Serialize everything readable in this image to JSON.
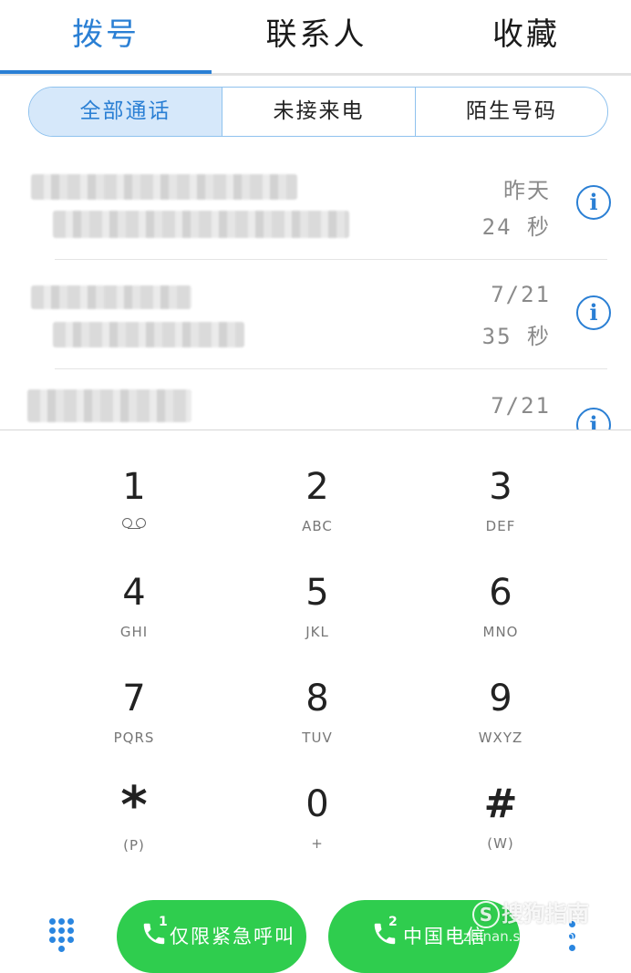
{
  "tabs": [
    {
      "label": "拨号",
      "active": true
    },
    {
      "label": "联系人",
      "active": false
    },
    {
      "label": "收藏",
      "active": false
    }
  ],
  "filters": [
    {
      "label": "全部通话",
      "active": true
    },
    {
      "label": "未接来电",
      "active": false
    },
    {
      "label": "陌生号码",
      "active": false
    }
  ],
  "call_log": [
    {
      "when": "昨天",
      "duration": "24 秒",
      "info_icon": "info-icon"
    },
    {
      "when": "7/21",
      "duration": "35 秒",
      "info_icon": "info-icon"
    },
    {
      "when": "7/21",
      "duration": "",
      "info_icon": "info-icon"
    }
  ],
  "keypad": [
    {
      "digit": "1",
      "letters": "",
      "icon": "voicemail-icon"
    },
    {
      "digit": "2",
      "letters": "ABC"
    },
    {
      "digit": "3",
      "letters": "DEF"
    },
    {
      "digit": "4",
      "letters": "GHI"
    },
    {
      "digit": "5",
      "letters": "JKL"
    },
    {
      "digit": "6",
      "letters": "MNO"
    },
    {
      "digit": "7",
      "letters": "PQRS"
    },
    {
      "digit": "8",
      "letters": "TUV"
    },
    {
      "digit": "9",
      "letters": "WXYZ"
    },
    {
      "digit": "*",
      "letters": "(P)"
    },
    {
      "digit": "0",
      "letters": "+"
    },
    {
      "digit": "#",
      "letters": "(W)"
    }
  ],
  "actions": {
    "call1": {
      "sim": "1",
      "label": "仅限紧急呼叫"
    },
    "call2": {
      "sim": "2",
      "label": "中国电信"
    },
    "dialpad_icon": "dialpad-grid-icon",
    "more_icon": "more-vert-icon"
  },
  "watermark": {
    "line1": "搜狗指南",
    "line2": "zhinan.sogou.com",
    "badge": "S"
  },
  "colors": {
    "accent": "#2a7fd4",
    "call_green": "#2fcd4e"
  }
}
